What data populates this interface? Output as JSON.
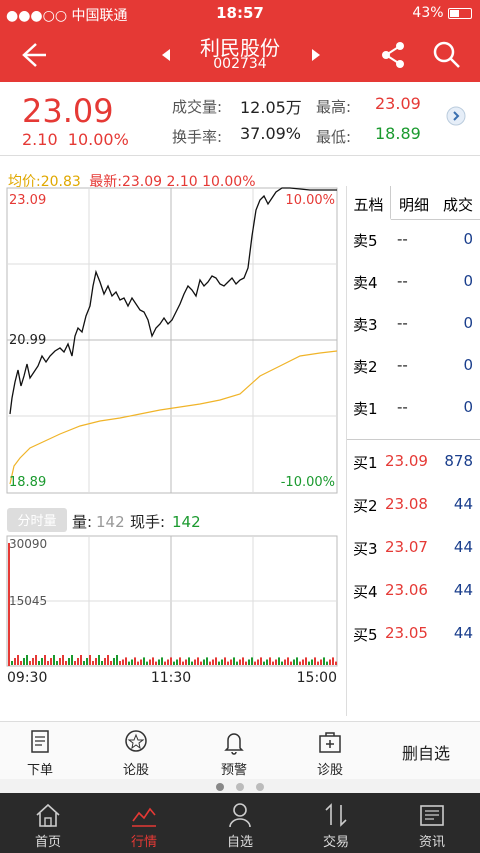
{
  "status": {
    "carrier": "●●●○○ 中国联通",
    "time": "18:57",
    "battery": "43%"
  },
  "header": {
    "title": "利民股份",
    "code": "002734"
  },
  "quote": {
    "price": "23.09",
    "change": "2.10",
    "change_pct": "10.00%",
    "volume_label": "成交量:",
    "volume_val": "12.05万",
    "turnover_label": "换手率:",
    "turnover_val": "37.09%",
    "high_label": "最高:",
    "high_val": "23.09",
    "low_label": "最低:",
    "low_val": "18.89"
  },
  "chart": {
    "avg_label": "均价:20.83",
    "latest_label": "最新:23.09 2.10 10.00%",
    "y_top": "23.09",
    "y_mid": "20.99",
    "y_bot": "18.89",
    "pct_top": "10.00%",
    "pct_bot": "-10.00%",
    "vol_button": "分时量",
    "vol_info_label": "量:",
    "vol_info_val": "142",
    "current_hand_label": "现手:",
    "current_hand_val": "142",
    "vol_top": "30090",
    "vol_mid": "15045",
    "time_start": "09:30",
    "time_mid": "11:30",
    "time_end": "15:00"
  },
  "orderbook": {
    "tabs": [
      "五档",
      "明细",
      "成交"
    ],
    "sells": [
      {
        "label": "卖5",
        "price": "--",
        "vol": "0"
      },
      {
        "label": "卖4",
        "price": "--",
        "vol": "0"
      },
      {
        "label": "卖3",
        "price": "--",
        "vol": "0"
      },
      {
        "label": "卖2",
        "price": "--",
        "vol": "0"
      },
      {
        "label": "卖1",
        "price": "--",
        "vol": "0"
      }
    ],
    "buys": [
      {
        "label": "买1",
        "price": "23.09",
        "vol": "878"
      },
      {
        "label": "买2",
        "price": "23.08",
        "vol": "44"
      },
      {
        "label": "买3",
        "price": "23.07",
        "vol": "44"
      },
      {
        "label": "买4",
        "price": "23.06",
        "vol": "44"
      },
      {
        "label": "买5",
        "price": "23.05",
        "vol": "44"
      }
    ]
  },
  "toolbar": {
    "items": [
      "下单",
      "论股",
      "预警",
      "诊股"
    ],
    "remove": "删自选"
  },
  "tabbar": {
    "items": [
      "首页",
      "行情",
      "自选",
      "交易",
      "资讯"
    ]
  },
  "colors": {
    "accent": "#e53935",
    "up": "#e53935",
    "down": "#1b9a2f",
    "vol_blue": "#1a3e8c"
  }
}
